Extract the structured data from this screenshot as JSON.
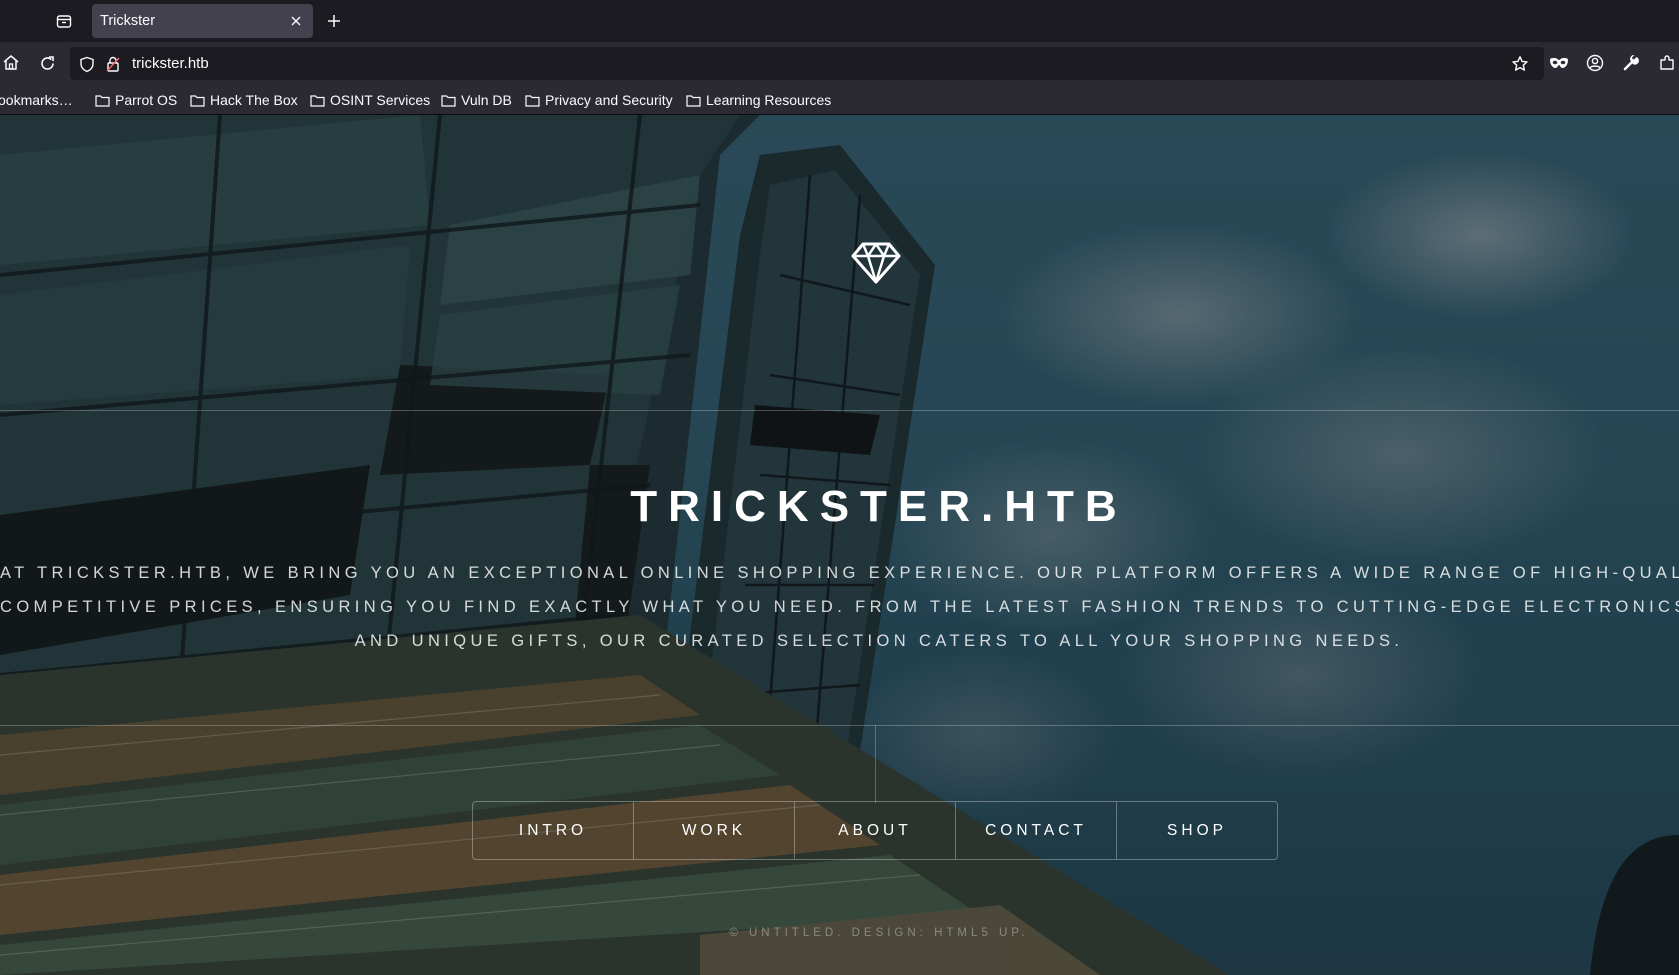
{
  "browser": {
    "tab": {
      "title": "Trickster"
    },
    "url": "trickster.htb",
    "bookmarks": [
      {
        "label": "ookmarks…"
      },
      {
        "label": "Parrot OS"
      },
      {
        "label": "Hack The Box"
      },
      {
        "label": "OSINT Services"
      },
      {
        "label": "Vuln DB"
      },
      {
        "label": "Privacy and Security"
      },
      {
        "label": "Learning Resources"
      }
    ],
    "icons": [
      "tab-list-icon",
      "close-icon",
      "new-tab-icon",
      "home-icon",
      "reload-icon",
      "shield-icon",
      "lock-icon",
      "star-icon",
      "mask-icon",
      "account-icon",
      "wrench-icon",
      "extensions-icon",
      "folder-icon"
    ]
  },
  "site": {
    "title": "TRICKSTER.HTB",
    "description_lines": [
      "AT TRICKSTER.HTB, WE BRING YOU AN EXCEPTIONAL ONLINE SHOPPING EXPERIENCE. OUR PLATFORM OFFERS A WIDE RANGE OF HIGH-QUALITY PRODUCTS AT",
      "COMPETITIVE PRICES, ENSURING YOU FIND EXACTLY WHAT YOU NEED. FROM THE LATEST FASHION TRENDS TO CUTTING-EDGE ELECTRONICS, HOME ESSENTIALS,",
      "AND UNIQUE GIFTS, OUR CURATED SELECTION CATERS TO ALL YOUR SHOPPING NEEDS."
    ],
    "menu": [
      {
        "label": "INTRO"
      },
      {
        "label": "WORK"
      },
      {
        "label": "ABOUT"
      },
      {
        "label": "CONTACT"
      },
      {
        "label": "SHOP"
      }
    ],
    "footer": "© UNTITLED. DESIGN: HTML5 UP.",
    "logo_icon": "diamond-icon"
  },
  "colors": {
    "tab_bar": "#1c1b22",
    "nav_bar": "#2b2a33",
    "active_tab": "#42414d",
    "text": "#fbfbfe"
  }
}
